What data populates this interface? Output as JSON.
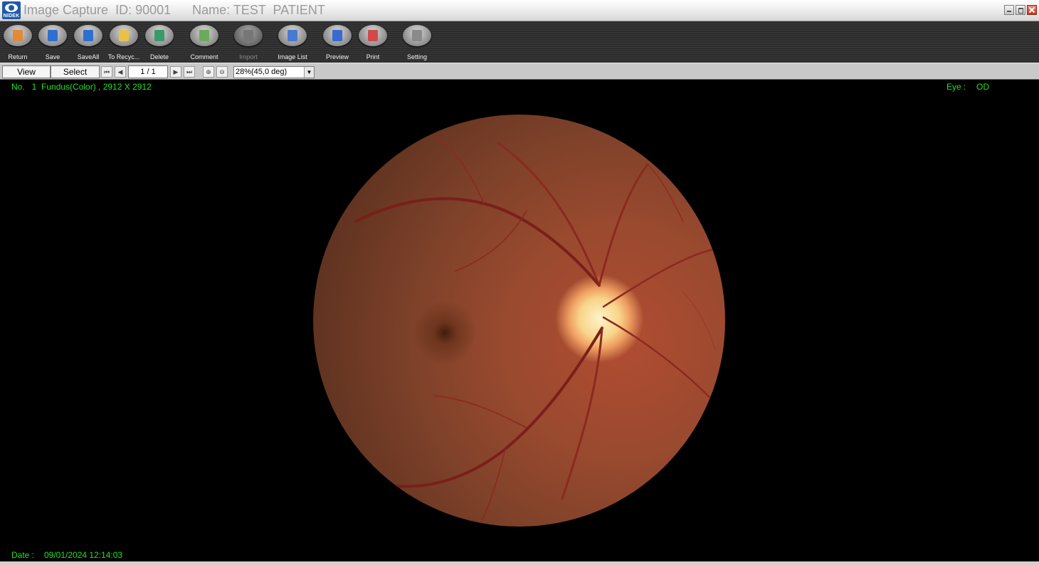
{
  "window": {
    "logo_text": "NIDEK",
    "title": "Image Capture  ID: 90001      Name: TEST  PATIENT"
  },
  "toolbar": {
    "items": [
      {
        "label": "Return",
        "icon": "return-icon",
        "color": "#e08a3a"
      },
      {
        "label": "Save",
        "icon": "save-disk-icon",
        "color": "#2f6fd0"
      },
      {
        "label": "SaveAll",
        "icon": "save-all-icon",
        "color": "#2f6fd0"
      },
      {
        "label": "To Recyc...",
        "icon": "folder-icon",
        "color": "#e6c24a"
      },
      {
        "label": "Delete",
        "icon": "recycle-bin-icon",
        "color": "#3a9a6a"
      },
      {
        "label": "Comment",
        "icon": "comment-icon",
        "color": "#6aaa5a"
      },
      {
        "label": "Import",
        "icon": "import-icon",
        "color": "#777777"
      },
      {
        "label": "Image List",
        "icon": "image-list-icon",
        "color": "#4a7ad0"
      },
      {
        "label": "Preview",
        "icon": "preview-magnifier-icon",
        "color": "#3a6ad0"
      },
      {
        "label": "Print",
        "icon": "printer-icon",
        "color": "#d04a4a"
      },
      {
        "label": "Setting",
        "icon": "settings-icon",
        "color": "#8a8a8a"
      }
    ]
  },
  "nav": {
    "view_label": "View",
    "select_label": "Select",
    "page_indicator": "1 / 1",
    "zoom_value": "28%(45,0 deg)"
  },
  "viewer": {
    "image_info": "No.   1  Fundus(Color) , 2912 X 2912",
    "eye_label": "Eye :",
    "eye_value": "OD",
    "date_label": "Date :",
    "date_value": "09/01/2024 12:14:03"
  },
  "colors": {
    "info_text": "#22e022",
    "toolbar_bg": "#2c2c2c",
    "title_text": "#9a9a9a"
  }
}
